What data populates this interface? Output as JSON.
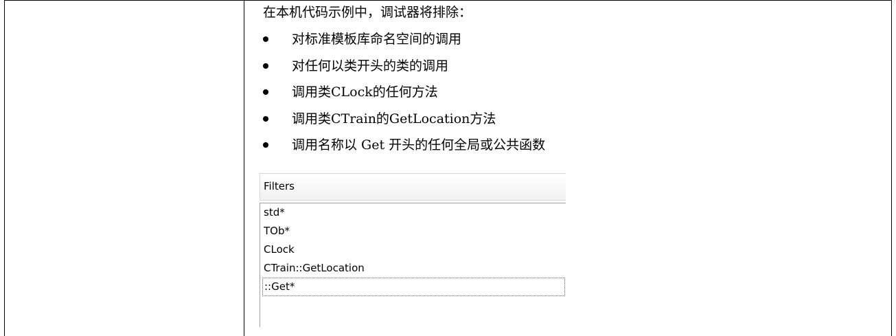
{
  "intro": "在本机代码示例中，调试器将排除：",
  "bullets": [
    "对标准模板库命名空间的调用",
    "对任何以类开头的类的调用",
    "调用类CLock的任何方法",
    "调用类CTrain的GetLocation方法",
    "调用名称以 Get 开头的任何全局或公共函数"
  ],
  "filters": {
    "title": "Filters",
    "items": [
      "std*",
      "TOb*",
      "CLock",
      "CTrain::GetLocation",
      "::Get*"
    ],
    "selected_index": 4
  }
}
